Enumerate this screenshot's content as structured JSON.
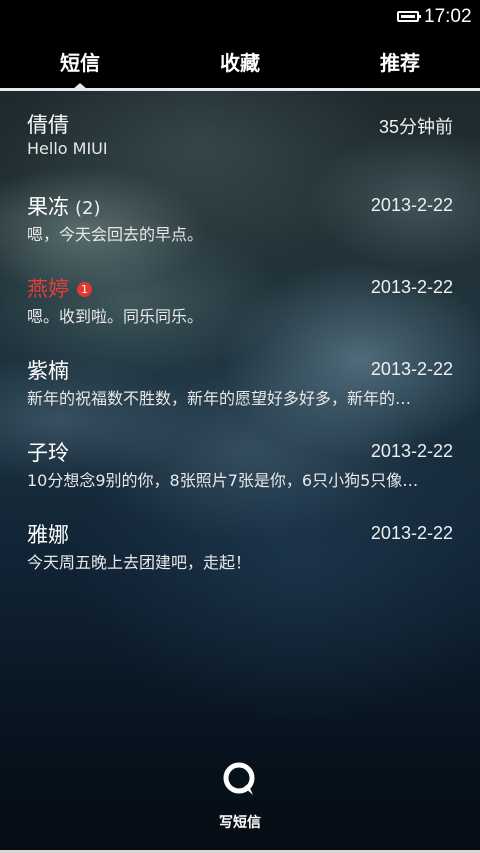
{
  "status_bar": {
    "time": "17:02",
    "battery_icon": "battery-icon"
  },
  "tabs": [
    {
      "label": "短信",
      "active": true
    },
    {
      "label": "收藏",
      "active": false
    },
    {
      "label": "推荐",
      "active": false
    }
  ],
  "conversations": [
    {
      "name": "倩倩",
      "count": "",
      "unread": false,
      "badge": "",
      "time": "35分钟前",
      "preview": "Hello MIUI"
    },
    {
      "name": "果冻",
      "count": "(2)",
      "unread": false,
      "badge": "",
      "time": "2013-2-22",
      "preview": "嗯，今天会回去的早点。"
    },
    {
      "name": "燕婷",
      "count": "",
      "unread": true,
      "badge": "1",
      "time": "2013-2-22",
      "preview": "嗯。收到啦。同乐同乐。"
    },
    {
      "name": "紫楠",
      "count": "",
      "unread": false,
      "badge": "",
      "time": "2013-2-22",
      "preview": "新年的祝福数不胜数，新年的愿望好多好多，新年的…"
    },
    {
      "name": "子玲",
      "count": "",
      "unread": false,
      "badge": "",
      "time": "2013-2-22",
      "preview": "10分想念9别的你，8张照片7张是你，6只小狗5只像…"
    },
    {
      "name": "雅娜",
      "count": "",
      "unread": false,
      "badge": "",
      "time": "2013-2-22",
      "preview": "今天周五晚上去团建吧，走起！"
    }
  ],
  "compose": {
    "label": "写短信",
    "icon": "compose-bubble-icon"
  },
  "colors": {
    "unread_name": "#e0403a",
    "badge": "#e0392f"
  }
}
